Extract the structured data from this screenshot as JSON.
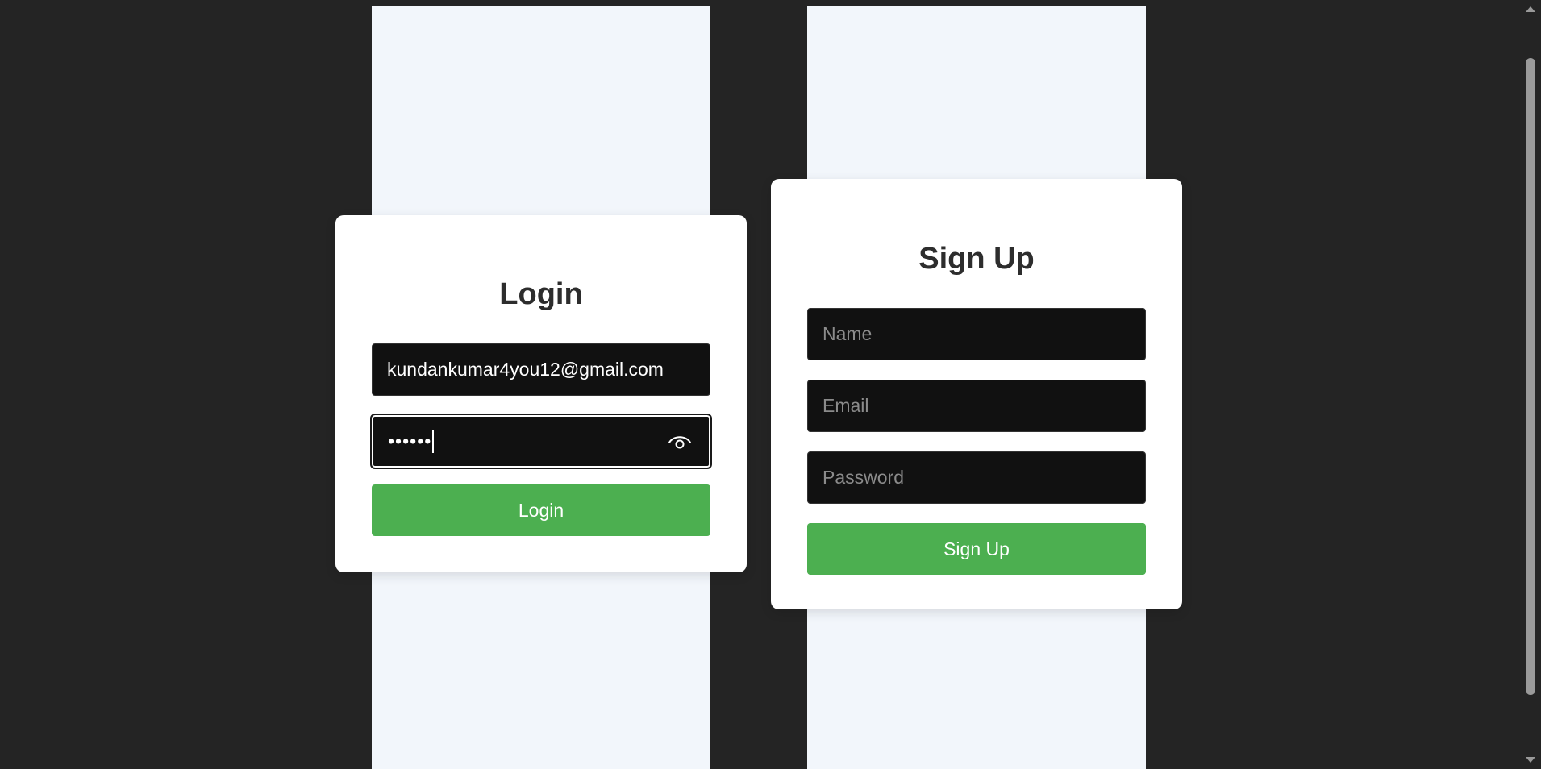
{
  "login": {
    "title": "Login",
    "email_value": "kundankumar4you12@gmail.com",
    "password_masked": "••••••",
    "show_password_icon": "eye-icon",
    "submit_label": "Login"
  },
  "signup": {
    "title": "Sign Up",
    "name_placeholder": "Name",
    "email_placeholder": "Email",
    "password_placeholder": "Password",
    "submit_label": "Sign Up"
  },
  "colors": {
    "background": "#242424",
    "panel": "#f2f6fb",
    "card": "#ffffff",
    "input": "#111111",
    "accent_green": "#4caf50"
  }
}
